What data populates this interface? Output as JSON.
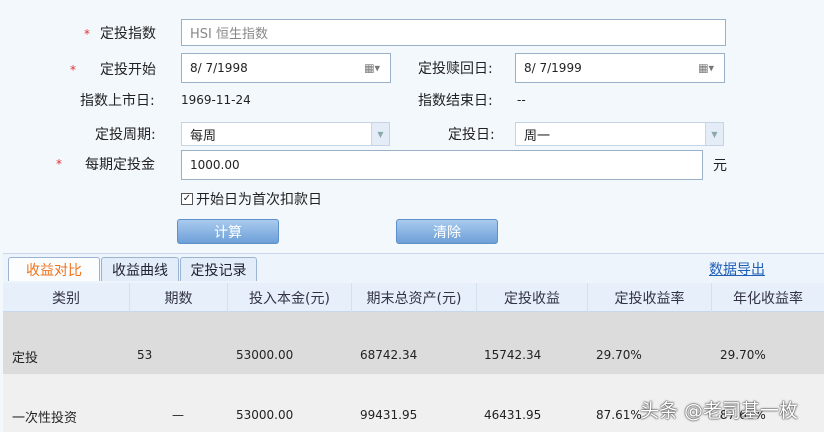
{
  "form": {
    "index_label": "定投指数",
    "index_value": "HSI 恒生指数",
    "start_label": "定投开始",
    "start_value": "8/ 7/1998",
    "redeem_label": "定投赎回日:",
    "redeem_value": "8/ 7/1999",
    "listing_label": "指数上市日:",
    "listing_value": "1969-11-24",
    "end_label": "指数结束日:",
    "end_value": "--",
    "period_label": "定投周期:",
    "period_value": "每周",
    "day_label": "定投日:",
    "day_value": "周一",
    "amount_label": "每期定投金",
    "amount_value": "1000.00",
    "amount_unit": "元",
    "required_mark": "*",
    "checkbox_label": "开始日为首次扣款日",
    "checkbox_checked": true,
    "calc_button": "计算",
    "clear_button": "清除"
  },
  "tabs": [
    {
      "label": "收益对比",
      "active": true
    },
    {
      "label": "收益曲线",
      "active": false
    },
    {
      "label": "定投记录",
      "active": false
    }
  ],
  "export_link": "数据导出",
  "table": {
    "headers": [
      "类别",
      "期数",
      "投入本金(元)",
      "期末总资产(元)",
      "定投收益",
      "定投收益率",
      "年化收益率"
    ],
    "rows": [
      [
        "定投",
        "53",
        "53000.00",
        "68742.34",
        "15742.34",
        "29.70%",
        "29.70%"
      ],
      [
        "一次性投资",
        "—",
        "53000.00",
        "99431.95",
        "46431.95",
        "87.61%",
        "87.61%"
      ]
    ]
  },
  "watermark": "头条 @老司基一枚"
}
